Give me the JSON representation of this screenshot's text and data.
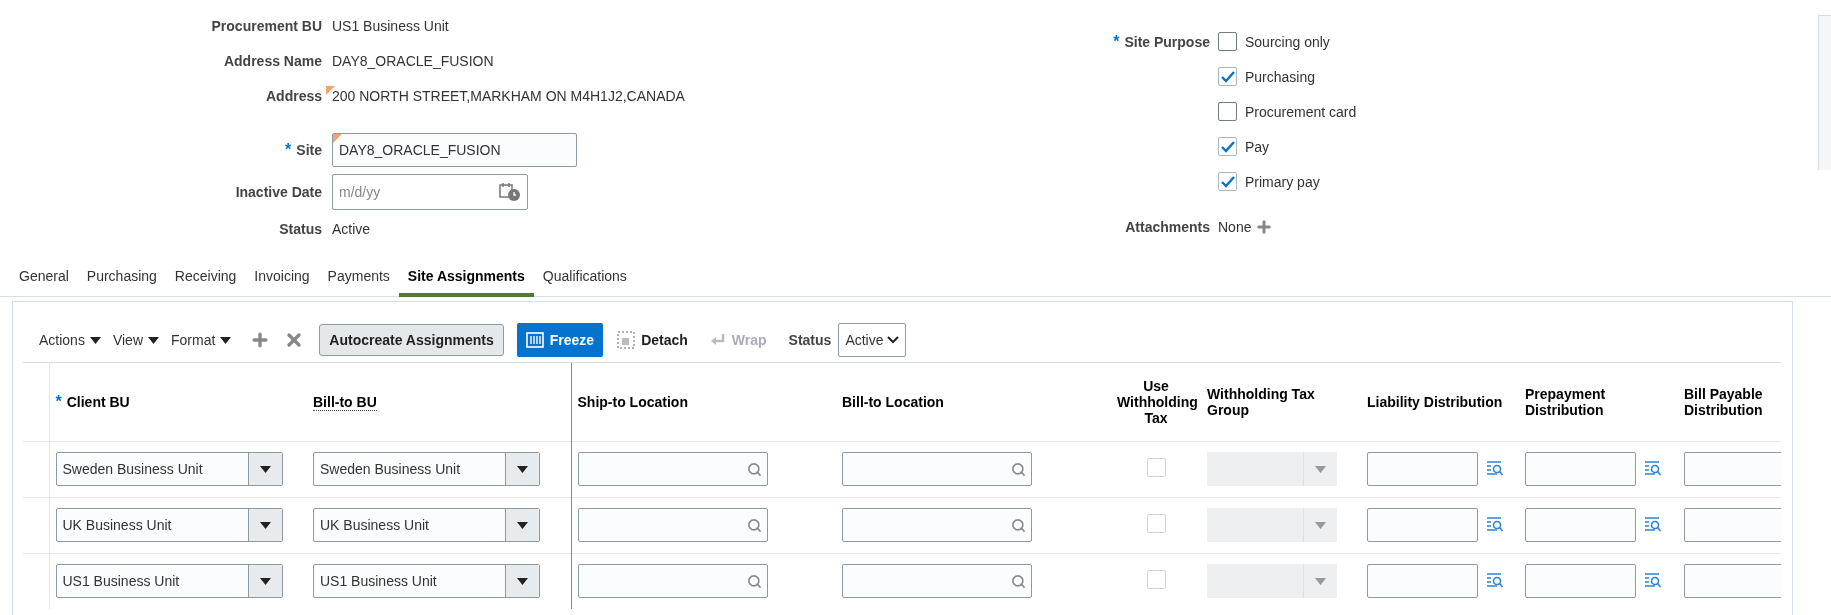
{
  "header_fields": [
    {
      "label": "Procurement BU",
      "value": "US1 Business Unit",
      "kind": "text"
    },
    {
      "label": "Address Name",
      "value": "DAY8_ORACLE_FUSION",
      "kind": "text"
    },
    {
      "label": "Address",
      "value": "200 NORTH STREET,MARKHAM ON M4H1J2,CANADA",
      "kind": "text",
      "changed": true
    },
    {
      "label": "Site",
      "value": "DAY8_ORACLE_FUSION",
      "kind": "input",
      "changed": true,
      "required_mark": "*"
    },
    {
      "label": "Inactive Date",
      "placeholder": "m/d/yy",
      "kind": "date"
    },
    {
      "label": "Status",
      "value": "Active",
      "kind": "text"
    }
  ],
  "site_purpose": {
    "label": "Site Purpose",
    "required_mark": "*",
    "options": [
      {
        "label": "Sourcing only",
        "checked": false
      },
      {
        "label": "Purchasing",
        "checked": true
      },
      {
        "label": "Procurement card",
        "checked": false
      },
      {
        "label": "Pay",
        "checked": true
      },
      {
        "label": "Primary pay",
        "checked": true
      }
    ]
  },
  "attachments": {
    "label": "Attachments",
    "value": "None"
  },
  "tabs": [
    {
      "label": "General",
      "selected": false
    },
    {
      "label": "Purchasing",
      "selected": false
    },
    {
      "label": "Receiving",
      "selected": false
    },
    {
      "label": "Invoicing",
      "selected": false
    },
    {
      "label": "Payments",
      "selected": false
    },
    {
      "label": "Site Assignments",
      "selected": true
    },
    {
      "label": "Qualifications",
      "selected": false
    }
  ],
  "toolbar": {
    "menus": [
      "Actions",
      "View",
      "Format"
    ],
    "autocreate": "Autocreate Assignments",
    "freeze": {
      "label": "Freeze",
      "selected": true
    },
    "detach": "Detach",
    "wrap": {
      "label": "Wrap",
      "disabled": true
    },
    "status": {
      "label": "Status",
      "value": "Active"
    }
  },
  "table": {
    "columns": [
      {
        "label": "Client BU",
        "kind": "select",
        "required_mark": "*"
      },
      {
        "label": "Bill-to BU",
        "kind": "select",
        "help": true
      },
      {
        "label": "Ship-to Location",
        "kind": "search",
        "frozen_edge": true
      },
      {
        "label": "Bill-to Location",
        "kind": "search"
      },
      {
        "label": "Use Withholding Tax",
        "kind": "checkbox"
      },
      {
        "label": "Withholding Tax Group",
        "kind": "disabled_select"
      },
      {
        "label": "Liability Distribution",
        "kind": "account"
      },
      {
        "label": "Prepayment Distribution",
        "kind": "account"
      },
      {
        "label": "Bill Payable Distribution",
        "kind": "account"
      }
    ],
    "rows": [
      {
        "client_bu": "Sweden Business Unit",
        "bill_to_bu": "Sweden Business Unit",
        "use_withholding_tax": false
      },
      {
        "client_bu": "UK Business Unit",
        "bill_to_bu": "UK Business Unit",
        "use_withholding_tax": false
      },
      {
        "client_bu": "US1 Business Unit",
        "bill_to_bu": "US1 Business Unit",
        "use_withholding_tax": false
      }
    ]
  }
}
